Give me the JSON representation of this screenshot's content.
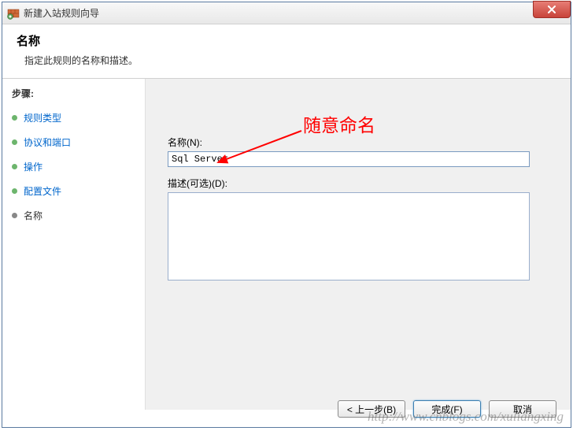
{
  "window": {
    "title": "新建入站规则向导"
  },
  "header": {
    "title": "名称",
    "subtitle": "指定此规则的名称和描述。"
  },
  "sidebar": {
    "title": "步骤:",
    "items": [
      {
        "label": "规则类型",
        "state": "done"
      },
      {
        "label": "协议和端口",
        "state": "done"
      },
      {
        "label": "操作",
        "state": "done"
      },
      {
        "label": "配置文件",
        "state": "done"
      },
      {
        "label": "名称",
        "state": "current"
      }
    ]
  },
  "form": {
    "name_label": "名称(N):",
    "name_value": "Sql Server",
    "desc_label": "描述(可选)(D):",
    "desc_value": ""
  },
  "annotation": {
    "text": "随意命名"
  },
  "buttons": {
    "back": "< 上一步(B)",
    "finish": "完成(F)",
    "cancel": "取消"
  },
  "watermark": "http://www.cnblogs.com/xuliangxing"
}
